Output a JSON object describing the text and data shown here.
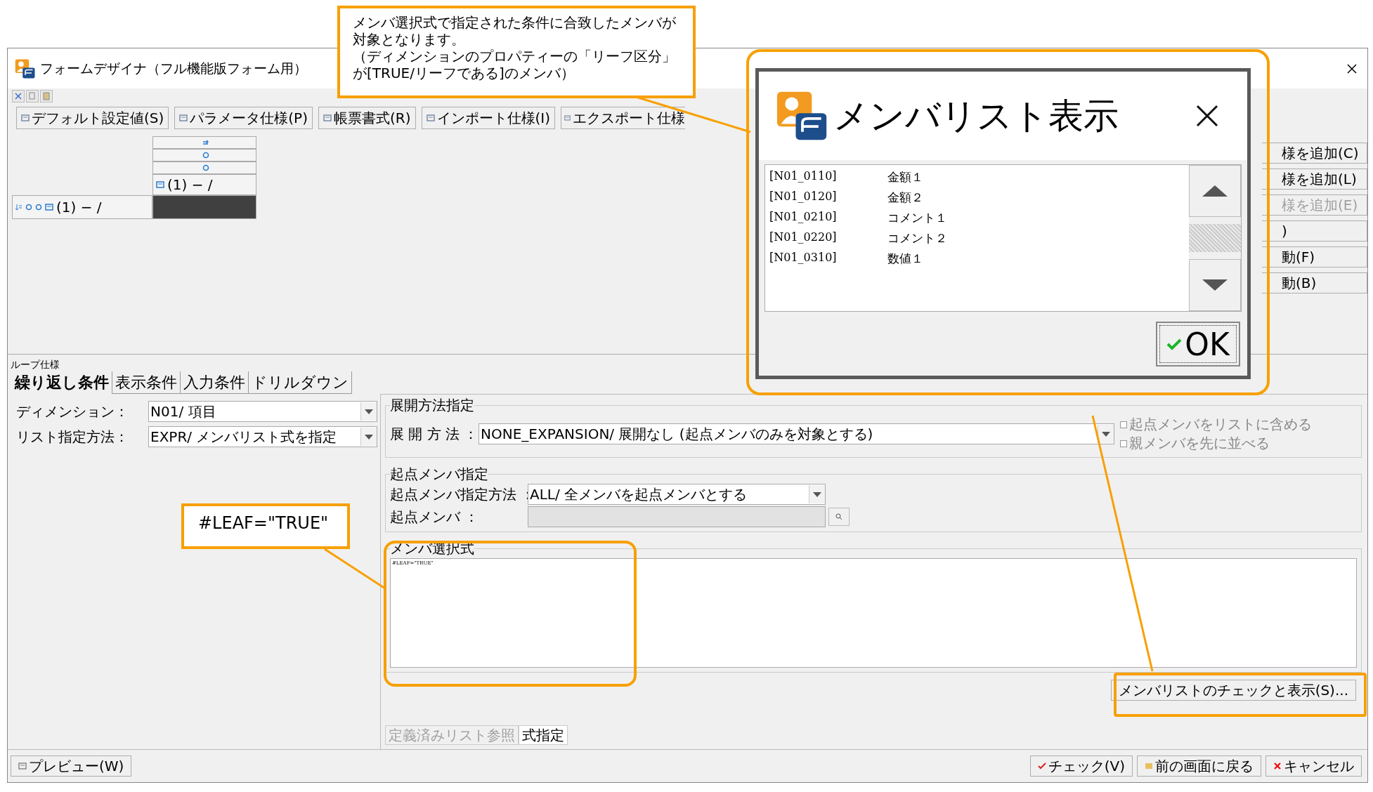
{
  "window": {
    "title": "フォームデザイナ（フル機能版フォーム用）"
  },
  "main_buttons": [
    {
      "label": "デフォルト設定値(S)"
    },
    {
      "label": "パラメータ仕様(P)"
    },
    {
      "label": "帳票書式(R)"
    },
    {
      "label": "インポート仕様(I)"
    },
    {
      "label": "エクスポート仕様"
    }
  ],
  "grid": {
    "column_header": "(1)  − /",
    "row_header": "(1)  − /"
  },
  "side_buttons": [
    {
      "label": "様を追加(C)",
      "disabled": false
    },
    {
      "label": "様を追加(L)",
      "disabled": false
    },
    {
      "label": "様を追加(E)",
      "disabled": true
    },
    {
      "label": ")",
      "disabled": false
    },
    {
      "label": "動(F)",
      "disabled": false
    },
    {
      "label": "動(B)",
      "disabled": false
    }
  ],
  "loop_spec": {
    "title": "ループ仕様",
    "tabs": [
      {
        "label": "繰り返し条件",
        "selected": true
      },
      {
        "label": "表示条件",
        "selected": false
      },
      {
        "label": "入力条件",
        "selected": false
      },
      {
        "label": "ドリルダウン",
        "selected": false
      }
    ]
  },
  "dimension": {
    "label": "ディメンション：",
    "value": "N01/ 項目"
  },
  "list_method": {
    "label": "リスト指定方法：",
    "value": "EXPR/ メンバリスト式を指定"
  },
  "expansion": {
    "title": "展開方法指定",
    "label": "展 開 方 法 ：",
    "value": "NONE_EXPANSION/ 展開なし (起点メンバのみを対象とする)",
    "options": [
      {
        "label": "起点メンバをリストに含める",
        "checked": false,
        "disabled": true
      },
      {
        "label": "親メンバを先に並べる",
        "checked": false,
        "disabled": true
      }
    ]
  },
  "start_member": {
    "title": "起点メンバ指定",
    "method_label": "起点メンバ指定方法 ：",
    "method_value": "ALL/ 全メンバを起点メンバとする",
    "member_label": "起点メンバ ：",
    "member_disabled": true
  },
  "expression": {
    "title": "メンバ選択式",
    "value": "#LEAF=\"TRUE\""
  },
  "check_button": "メンバリストのチェックと表示(S)...",
  "source_tabs": [
    {
      "label": "定義済みリスト参照",
      "selected": false
    },
    {
      "label": "式指定",
      "selected": true
    }
  ],
  "footer": {
    "preview": "プレビュー(W)",
    "buttons": [
      {
        "label": "チェック(V)",
        "kind": "check"
      },
      {
        "label": "前の画面に戻る",
        "kind": "back"
      },
      {
        "label": "キャンセル",
        "kind": "cancel"
      }
    ]
  },
  "dialog": {
    "title": "メンバリスト表示",
    "items": [
      {
        "code": "[N01_0110]",
        "name": "金額１"
      },
      {
        "code": "[N01_0120]",
        "name": "金額２"
      },
      {
        "code": "[N01_0210]",
        "name": "コメント１"
      },
      {
        "code": "[N01_0220]",
        "name": "コメント２"
      },
      {
        "code": "[N01_0310]",
        "name": "数値１"
      }
    ],
    "ok": "OK"
  },
  "callouts": [
    {
      "paragraphs": [
        "メンバ選択式で指定された条件に合致したメンバが対象となります。",
        "（ディメンションのプロパティーの「リーフ区分」が[TRUE/リーフである]のメンバ）"
      ]
    },
    {
      "paragraphs": [
        "#LEAF=\"TRUE\""
      ]
    }
  ]
}
